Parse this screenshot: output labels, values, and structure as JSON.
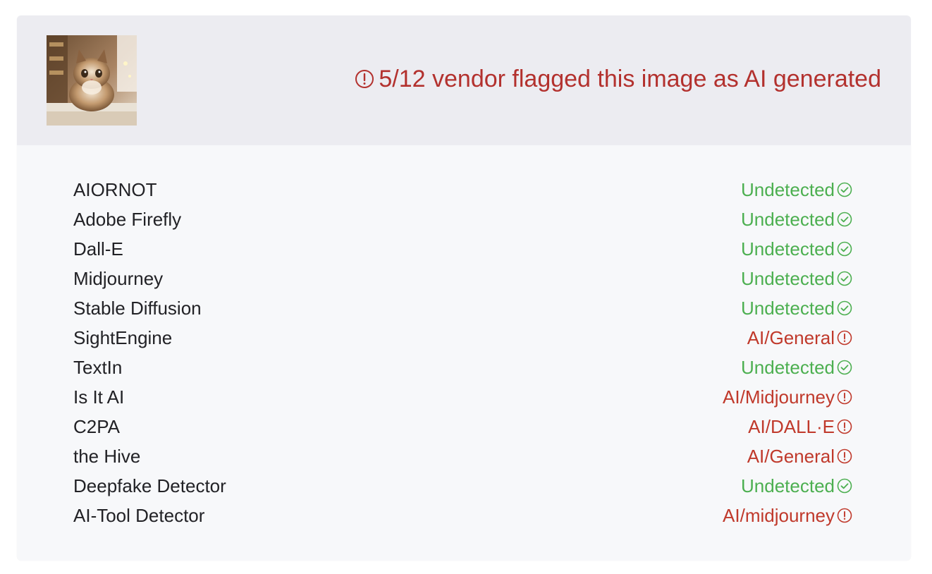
{
  "header": {
    "summary": "5/12 vendor flagged this image as AI generated",
    "summary_icon": "alert-circle-icon",
    "thumbnail_alt": "cat photo thumbnail"
  },
  "colors": {
    "flagged": "#b3312e",
    "undetected": "#4caf50",
    "header_bg": "#ececf1",
    "body_bg": "#f7f8fa"
  },
  "vendors": [
    {
      "name": "AIORNOT",
      "status": "Undetected",
      "flagged": false,
      "icon": "check-circle-icon"
    },
    {
      "name": "Adobe Firefly",
      "status": "Undetected",
      "flagged": false,
      "icon": "check-circle-icon"
    },
    {
      "name": "Dall-E",
      "status": "Undetected",
      "flagged": false,
      "icon": "check-circle-icon"
    },
    {
      "name": "Midjourney",
      "status": "Undetected",
      "flagged": false,
      "icon": "check-circle-icon"
    },
    {
      "name": "Stable Diffusion",
      "status": "Undetected",
      "flagged": false,
      "icon": "check-circle-icon"
    },
    {
      "name": "SightEngine",
      "status": "AI/General",
      "flagged": true,
      "icon": "alert-circle-icon"
    },
    {
      "name": "TextIn",
      "status": "Undetected",
      "flagged": false,
      "icon": "check-circle-icon"
    },
    {
      "name": "Is It AI",
      "status": "AI/Midjourney",
      "flagged": true,
      "icon": "alert-circle-icon"
    },
    {
      "name": "C2PA",
      "status": "AI/DALL·E",
      "flagged": true,
      "icon": "alert-circle-icon"
    },
    {
      "name": "the Hive",
      "status": "AI/General",
      "flagged": true,
      "icon": "alert-circle-icon"
    },
    {
      "name": "Deepfake Detector",
      "status": "Undetected",
      "flagged": false,
      "icon": "check-circle-icon"
    },
    {
      "name": "AI-Tool Detector",
      "status": "AI/midjourney",
      "flagged": true,
      "icon": "alert-circle-icon"
    }
  ]
}
